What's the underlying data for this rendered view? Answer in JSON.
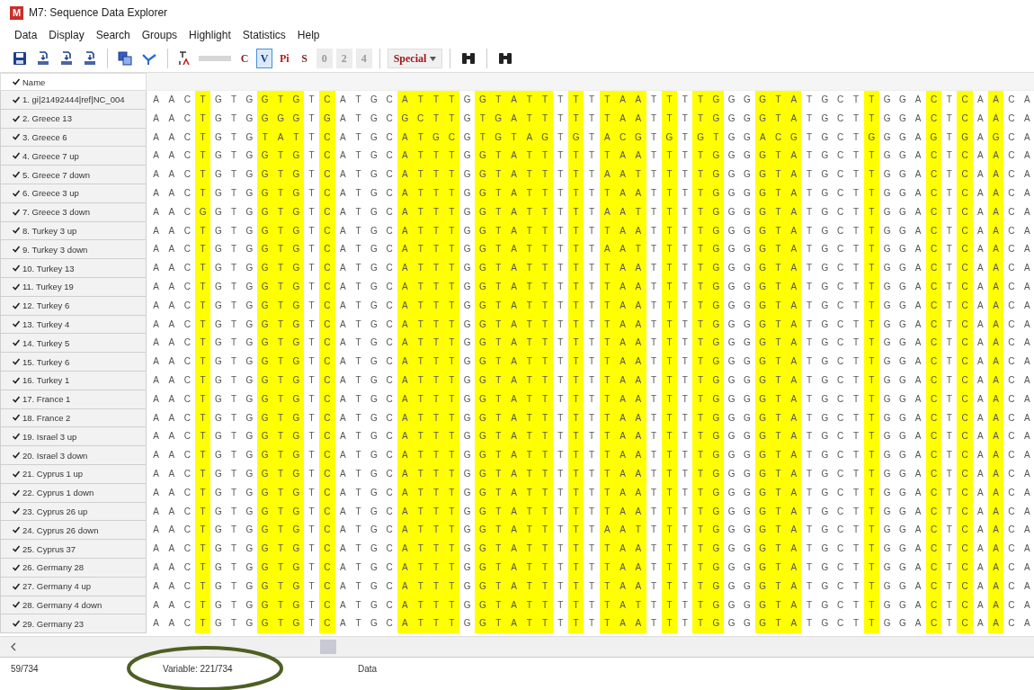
{
  "window": {
    "app_icon_letter": "M",
    "title": "M7: Sequence Data Explorer"
  },
  "menu": [
    "Data",
    "Display",
    "Search",
    "Groups",
    "Highlight",
    "Statistics",
    "Help"
  ],
  "toolbar_toggles": [
    {
      "label": "C",
      "selected": false,
      "disabled": false,
      "color": "#8b1c1c"
    },
    {
      "label": "V",
      "selected": true,
      "disabled": false,
      "color": "#1c3c8b"
    },
    {
      "label": "Pi",
      "selected": false,
      "disabled": false,
      "color": "#c01818"
    },
    {
      "label": "S",
      "selected": false,
      "disabled": false,
      "color": "#7a2a2a"
    },
    {
      "label": "0",
      "selected": false,
      "disabled": true,
      "color": "#9a9a9a"
    },
    {
      "label": "2",
      "selected": false,
      "disabled": true,
      "color": "#9a9a9a"
    },
    {
      "label": "4",
      "selected": false,
      "disabled": true,
      "color": "#9a9a9a"
    }
  ],
  "special_menu": {
    "label": "Special"
  },
  "name_header": {
    "label": "Name",
    "checked": true
  },
  "sites": [
    {
      "variable": false
    },
    {
      "variable": false
    },
    {
      "variable": false
    },
    {
      "variable": true
    },
    {
      "variable": false
    },
    {
      "variable": false
    },
    {
      "variable": false
    },
    {
      "variable": true
    },
    {
      "variable": true
    },
    {
      "variable": true
    },
    {
      "variable": false
    },
    {
      "variable": true
    },
    {
      "variable": false
    },
    {
      "variable": false
    },
    {
      "variable": false
    },
    {
      "variable": false
    },
    {
      "variable": true
    },
    {
      "variable": true
    },
    {
      "variable": true
    },
    {
      "variable": true
    },
    {
      "variable": false
    },
    {
      "variable": true
    },
    {
      "variable": true
    },
    {
      "variable": true
    },
    {
      "variable": true
    },
    {
      "variable": true
    },
    {
      "variable": false
    },
    {
      "variable": true
    },
    {
      "variable": false
    },
    {
      "variable": true
    },
    {
      "variable": true
    },
    {
      "variable": true
    },
    {
      "variable": false
    },
    {
      "variable": true
    },
    {
      "variable": false
    },
    {
      "variable": true
    },
    {
      "variable": true
    },
    {
      "variable": false
    },
    {
      "variable": false
    },
    {
      "variable": true
    },
    {
      "variable": true
    },
    {
      "variable": true
    },
    {
      "variable": false
    },
    {
      "variable": false
    },
    {
      "variable": false
    },
    {
      "variable": false
    },
    {
      "variable": true
    },
    {
      "variable": false
    },
    {
      "variable": false
    },
    {
      "variable": false
    },
    {
      "variable": true
    },
    {
      "variable": false
    },
    {
      "variable": true
    },
    {
      "variable": false
    },
    {
      "variable": true
    },
    {
      "variable": false
    },
    {
      "variable": false
    }
  ],
  "rows": [
    {
      "name": "1. gi|21492444|ref|NC_004",
      "checked": true,
      "sequence": [
        "A",
        "A",
        "C",
        "T",
        "G",
        "T",
        "G",
        "G",
        "T",
        "G",
        "T",
        "C",
        "A",
        "T",
        "G",
        "C",
        "A",
        "T",
        "T",
        "T",
        "G",
        "G",
        "T",
        "A",
        "T",
        "T",
        "T",
        "T",
        "T",
        "T",
        "A",
        "A",
        "T",
        "T",
        "T",
        "T",
        "G",
        "G",
        "G",
        "G",
        "T",
        "A",
        "T",
        "G",
        "C",
        "T",
        "T",
        "G",
        "G",
        "A",
        "C",
        "T",
        "C",
        "A",
        "A",
        "C",
        "A"
      ]
    },
    {
      "name": "2. Greece 13",
      "checked": true,
      "sequence": [
        "A",
        "A",
        "C",
        "T",
        "G",
        "T",
        "G",
        "G",
        "G",
        "G",
        "T",
        "G",
        "A",
        "T",
        "G",
        "C",
        "G",
        "C",
        "T",
        "T",
        "G",
        "T",
        "G",
        "A",
        "T",
        "T",
        "T",
        "T",
        "T",
        "T",
        "A",
        "A",
        "T",
        "T",
        "T",
        "T",
        "G",
        "G",
        "G",
        "G",
        "T",
        "A",
        "T",
        "G",
        "C",
        "T",
        "T",
        "G",
        "G",
        "A",
        "C",
        "T",
        "C",
        "A",
        "A",
        "C",
        "A"
      ]
    },
    {
      "name": "3. Greece 6",
      "checked": true,
      "sequence": [
        "A",
        "A",
        "C",
        "T",
        "G",
        "T",
        "G",
        "T",
        "A",
        "T",
        "T",
        "C",
        "A",
        "T",
        "G",
        "C",
        "A",
        "T",
        "G",
        "C",
        "G",
        "T",
        "G",
        "T",
        "A",
        "G",
        "T",
        "G",
        "T",
        "A",
        "C",
        "G",
        "T",
        "G",
        "T",
        "G",
        "T",
        "G",
        "G",
        "A",
        "C",
        "G",
        "T",
        "G",
        "C",
        "T",
        "G",
        "G",
        "G",
        "A",
        "G",
        "T",
        "G",
        "A",
        "G",
        "C",
        "A"
      ]
    },
    {
      "name": "4. Greece 7 up",
      "checked": true,
      "sequence": [
        "A",
        "A",
        "C",
        "T",
        "G",
        "T",
        "G",
        "G",
        "T",
        "G",
        "T",
        "C",
        "A",
        "T",
        "G",
        "C",
        "A",
        "T",
        "T",
        "T",
        "G",
        "G",
        "T",
        "A",
        "T",
        "T",
        "T",
        "T",
        "T",
        "T",
        "A",
        "A",
        "T",
        "T",
        "T",
        "T",
        "G",
        "G",
        "G",
        "G",
        "T",
        "A",
        "T",
        "G",
        "C",
        "T",
        "T",
        "G",
        "G",
        "A",
        "C",
        "T",
        "C",
        "A",
        "A",
        "C",
        "A"
      ]
    },
    {
      "name": "5. Greece 7 down",
      "checked": true,
      "sequence": [
        "A",
        "A",
        "C",
        "T",
        "G",
        "T",
        "G",
        "G",
        "T",
        "G",
        "T",
        "C",
        "A",
        "T",
        "G",
        "C",
        "A",
        "T",
        "T",
        "T",
        "G",
        "G",
        "T",
        "A",
        "T",
        "T",
        "T",
        "T",
        "T",
        "A",
        "A",
        "T",
        "T",
        "T",
        "T",
        "T",
        "G",
        "G",
        "G",
        "G",
        "T",
        "A",
        "T",
        "G",
        "C",
        "T",
        "T",
        "G",
        "G",
        "A",
        "C",
        "T",
        "C",
        "A",
        "A",
        "C",
        "A"
      ]
    },
    {
      "name": "6. Greece 3 up",
      "checked": true,
      "sequence": [
        "A",
        "A",
        "C",
        "T",
        "G",
        "T",
        "G",
        "G",
        "T",
        "G",
        "T",
        "C",
        "A",
        "T",
        "G",
        "C",
        "A",
        "T",
        "T",
        "T",
        "G",
        "G",
        "T",
        "A",
        "T",
        "T",
        "T",
        "T",
        "T",
        "T",
        "A",
        "A",
        "T",
        "T",
        "T",
        "T",
        "G",
        "G",
        "G",
        "G",
        "T",
        "A",
        "T",
        "G",
        "C",
        "T",
        "T",
        "G",
        "G",
        "A",
        "C",
        "T",
        "C",
        "A",
        "A",
        "C",
        "A"
      ]
    },
    {
      "name": "7. Greece 3 down",
      "checked": true,
      "sequence": [
        "A",
        "A",
        "C",
        "G",
        "G",
        "T",
        "G",
        "G",
        "T",
        "G",
        "T",
        "C",
        "A",
        "T",
        "G",
        "C",
        "A",
        "T",
        "T",
        "T",
        "G",
        "G",
        "T",
        "A",
        "T",
        "T",
        "T",
        "T",
        "T",
        "A",
        "A",
        "T",
        "T",
        "T",
        "T",
        "T",
        "G",
        "G",
        "G",
        "G",
        "T",
        "A",
        "T",
        "G",
        "C",
        "T",
        "T",
        "G",
        "G",
        "A",
        "C",
        "T",
        "C",
        "A",
        "A",
        "C",
        "A"
      ]
    },
    {
      "name": "8. Turkey 3 up",
      "checked": true,
      "sequence": [
        "A",
        "A",
        "C",
        "T",
        "G",
        "T",
        "G",
        "G",
        "T",
        "G",
        "T",
        "C",
        "A",
        "T",
        "G",
        "C",
        "A",
        "T",
        "T",
        "T",
        "G",
        "G",
        "T",
        "A",
        "T",
        "T",
        "T",
        "T",
        "T",
        "T",
        "A",
        "A",
        "T",
        "T",
        "T",
        "T",
        "G",
        "G",
        "G",
        "G",
        "T",
        "A",
        "T",
        "G",
        "C",
        "T",
        "T",
        "G",
        "G",
        "A",
        "C",
        "T",
        "C",
        "A",
        "A",
        "C",
        "A"
      ]
    },
    {
      "name": "9. Turkey 3 down",
      "checked": true,
      "sequence": [
        "A",
        "A",
        "C",
        "T",
        "G",
        "T",
        "G",
        "G",
        "T",
        "G",
        "T",
        "C",
        "A",
        "T",
        "G",
        "C",
        "A",
        "T",
        "T",
        "T",
        "G",
        "G",
        "T",
        "A",
        "T",
        "T",
        "T",
        "T",
        "T",
        "A",
        "A",
        "T",
        "T",
        "T",
        "T",
        "T",
        "G",
        "G",
        "G",
        "G",
        "T",
        "A",
        "T",
        "G",
        "C",
        "T",
        "T",
        "G",
        "G",
        "A",
        "C",
        "T",
        "C",
        "A",
        "A",
        "C",
        "A"
      ]
    },
    {
      "name": "10. Turkey 13",
      "checked": true,
      "sequence": [
        "A",
        "A",
        "C",
        "T",
        "G",
        "T",
        "G",
        "G",
        "T",
        "G",
        "T",
        "C",
        "A",
        "T",
        "G",
        "C",
        "A",
        "T",
        "T",
        "T",
        "G",
        "G",
        "T",
        "A",
        "T",
        "T",
        "T",
        "T",
        "T",
        "T",
        "A",
        "A",
        "T",
        "T",
        "T",
        "T",
        "G",
        "G",
        "G",
        "G",
        "T",
        "A",
        "T",
        "G",
        "C",
        "T",
        "T",
        "G",
        "G",
        "A",
        "C",
        "T",
        "C",
        "A",
        "A",
        "C",
        "A"
      ]
    },
    {
      "name": "11. Turkey 19",
      "checked": true,
      "sequence": [
        "A",
        "A",
        "C",
        "T",
        "G",
        "T",
        "G",
        "G",
        "T",
        "G",
        "T",
        "C",
        "A",
        "T",
        "G",
        "C",
        "A",
        "T",
        "T",
        "T",
        "G",
        "G",
        "T",
        "A",
        "T",
        "T",
        "T",
        "T",
        "T",
        "T",
        "A",
        "A",
        "T",
        "T",
        "T",
        "T",
        "G",
        "G",
        "G",
        "G",
        "T",
        "A",
        "T",
        "G",
        "C",
        "T",
        "T",
        "G",
        "G",
        "A",
        "C",
        "T",
        "C",
        "A",
        "A",
        "C",
        "A"
      ]
    },
    {
      "name": "12. Turkey 6",
      "checked": true,
      "sequence": [
        "A",
        "A",
        "C",
        "T",
        "G",
        "T",
        "G",
        "G",
        "T",
        "G",
        "T",
        "C",
        "A",
        "T",
        "G",
        "C",
        "A",
        "T",
        "T",
        "T",
        "G",
        "G",
        "T",
        "A",
        "T",
        "T",
        "T",
        "T",
        "T",
        "T",
        "A",
        "A",
        "T",
        "T",
        "T",
        "T",
        "G",
        "G",
        "G",
        "G",
        "T",
        "A",
        "T",
        "G",
        "C",
        "T",
        "T",
        "G",
        "G",
        "A",
        "C",
        "T",
        "C",
        "A",
        "A",
        "C",
        "A"
      ]
    },
    {
      "name": "13. Turkey 4",
      "checked": true,
      "sequence": [
        "A",
        "A",
        "C",
        "T",
        "G",
        "T",
        "G",
        "G",
        "T",
        "G",
        "T",
        "C",
        "A",
        "T",
        "G",
        "C",
        "A",
        "T",
        "T",
        "T",
        "G",
        "G",
        "T",
        "A",
        "T",
        "T",
        "T",
        "T",
        "T",
        "T",
        "A",
        "A",
        "T",
        "T",
        "T",
        "T",
        "G",
        "G",
        "G",
        "G",
        "T",
        "A",
        "T",
        "G",
        "C",
        "T",
        "T",
        "G",
        "G",
        "A",
        "C",
        "T",
        "C",
        "A",
        "A",
        "C",
        "A"
      ]
    },
    {
      "name": "14. Turkey 5",
      "checked": true,
      "sequence": [
        "A",
        "A",
        "C",
        "T",
        "G",
        "T",
        "G",
        "G",
        "T",
        "G",
        "T",
        "C",
        "A",
        "T",
        "G",
        "C",
        "A",
        "T",
        "T",
        "T",
        "G",
        "G",
        "T",
        "A",
        "T",
        "T",
        "T",
        "T",
        "T",
        "T",
        "A",
        "A",
        "T",
        "T",
        "T",
        "T",
        "G",
        "G",
        "G",
        "G",
        "T",
        "A",
        "T",
        "G",
        "C",
        "T",
        "T",
        "G",
        "G",
        "A",
        "C",
        "T",
        "C",
        "A",
        "A",
        "C",
        "A"
      ]
    },
    {
      "name": "15. Turkey 6",
      "checked": true,
      "sequence": [
        "A",
        "A",
        "C",
        "T",
        "G",
        "T",
        "G",
        "G",
        "T",
        "G",
        "T",
        "C",
        "A",
        "T",
        "G",
        "C",
        "A",
        "T",
        "T",
        "T",
        "G",
        "G",
        "T",
        "A",
        "T",
        "T",
        "T",
        "T",
        "T",
        "T",
        "A",
        "A",
        "T",
        "T",
        "T",
        "T",
        "G",
        "G",
        "G",
        "G",
        "T",
        "A",
        "T",
        "G",
        "C",
        "T",
        "T",
        "G",
        "G",
        "A",
        "C",
        "T",
        "C",
        "A",
        "A",
        "C",
        "A"
      ]
    },
    {
      "name": "16. Turkey 1",
      "checked": true,
      "sequence": [
        "A",
        "A",
        "C",
        "T",
        "G",
        "T",
        "G",
        "G",
        "T",
        "G",
        "T",
        "C",
        "A",
        "T",
        "G",
        "C",
        "A",
        "T",
        "T",
        "T",
        "G",
        "G",
        "T",
        "A",
        "T",
        "T",
        "T",
        "T",
        "T",
        "T",
        "A",
        "A",
        "T",
        "T",
        "T",
        "T",
        "G",
        "G",
        "G",
        "G",
        "T",
        "A",
        "T",
        "G",
        "C",
        "T",
        "T",
        "G",
        "G",
        "A",
        "C",
        "T",
        "C",
        "A",
        "A",
        "C",
        "A"
      ]
    },
    {
      "name": "17. France 1",
      "checked": true,
      "sequence": [
        "A",
        "A",
        "C",
        "T",
        "G",
        "T",
        "G",
        "G",
        "T",
        "G",
        "T",
        "C",
        "A",
        "T",
        "G",
        "C",
        "A",
        "T",
        "T",
        "T",
        "G",
        "G",
        "T",
        "A",
        "T",
        "T",
        "T",
        "T",
        "T",
        "T",
        "A",
        "A",
        "T",
        "T",
        "T",
        "T",
        "G",
        "G",
        "G",
        "G",
        "T",
        "A",
        "T",
        "G",
        "C",
        "T",
        "T",
        "G",
        "G",
        "A",
        "C",
        "T",
        "C",
        "A",
        "A",
        "C",
        "A"
      ]
    },
    {
      "name": "18. France 2",
      "checked": true,
      "sequence": [
        "A",
        "A",
        "C",
        "T",
        "G",
        "T",
        "G",
        "G",
        "T",
        "G",
        "T",
        "C",
        "A",
        "T",
        "G",
        "C",
        "A",
        "T",
        "T",
        "T",
        "G",
        "G",
        "T",
        "A",
        "T",
        "T",
        "T",
        "T",
        "T",
        "T",
        "A",
        "A",
        "T",
        "T",
        "T",
        "T",
        "G",
        "G",
        "G",
        "G",
        "T",
        "A",
        "T",
        "G",
        "C",
        "T",
        "T",
        "G",
        "G",
        "A",
        "C",
        "T",
        "C",
        "A",
        "A",
        "C",
        "A"
      ]
    },
    {
      "name": "19. Israel 3 up",
      "checked": true,
      "sequence": [
        "A",
        "A",
        "C",
        "T",
        "G",
        "T",
        "G",
        "G",
        "T",
        "G",
        "T",
        "C",
        "A",
        "T",
        "G",
        "C",
        "A",
        "T",
        "T",
        "T",
        "G",
        "G",
        "T",
        "A",
        "T",
        "T",
        "T",
        "T",
        "T",
        "T",
        "A",
        "A",
        "T",
        "T",
        "T",
        "T",
        "G",
        "G",
        "G",
        "G",
        "T",
        "A",
        "T",
        "G",
        "C",
        "T",
        "T",
        "G",
        "G",
        "A",
        "C",
        "T",
        "C",
        "A",
        "A",
        "C",
        "A"
      ]
    },
    {
      "name": "20. Israel 3 down",
      "checked": true,
      "sequence": [
        "A",
        "A",
        "C",
        "T",
        "G",
        "T",
        "G",
        "G",
        "T",
        "G",
        "T",
        "C",
        "A",
        "T",
        "G",
        "C",
        "A",
        "T",
        "T",
        "T",
        "G",
        "G",
        "T",
        "A",
        "T",
        "T",
        "T",
        "T",
        "T",
        "T",
        "A",
        "A",
        "T",
        "T",
        "T",
        "T",
        "G",
        "G",
        "G",
        "G",
        "T",
        "A",
        "T",
        "G",
        "C",
        "T",
        "T",
        "G",
        "G",
        "A",
        "C",
        "T",
        "C",
        "A",
        "A",
        "C",
        "A"
      ]
    },
    {
      "name": "21. Cyprus 1 up",
      "checked": true,
      "sequence": [
        "A",
        "A",
        "C",
        "T",
        "G",
        "T",
        "G",
        "G",
        "T",
        "G",
        "T",
        "C",
        "A",
        "T",
        "G",
        "C",
        "A",
        "T",
        "T",
        "T",
        "G",
        "G",
        "T",
        "A",
        "T",
        "T",
        "T",
        "T",
        "T",
        "T",
        "A",
        "A",
        "T",
        "T",
        "T",
        "T",
        "G",
        "G",
        "G",
        "G",
        "T",
        "A",
        "T",
        "G",
        "C",
        "T",
        "T",
        "G",
        "G",
        "A",
        "C",
        "T",
        "C",
        "A",
        "A",
        "C",
        "A"
      ]
    },
    {
      "name": "22. Cyprus 1 down",
      "checked": true,
      "sequence": [
        "A",
        "A",
        "C",
        "T",
        "G",
        "T",
        "G",
        "G",
        "T",
        "G",
        "T",
        "C",
        "A",
        "T",
        "G",
        "C",
        "A",
        "T",
        "T",
        "T",
        "G",
        "G",
        "T",
        "A",
        "T",
        "T",
        "T",
        "T",
        "T",
        "T",
        "A",
        "A",
        "T",
        "T",
        "T",
        "T",
        "G",
        "G",
        "G",
        "G",
        "T",
        "A",
        "T",
        "G",
        "C",
        "T",
        "T",
        "G",
        "G",
        "A",
        "C",
        "T",
        "C",
        "A",
        "A",
        "C",
        "A"
      ]
    },
    {
      "name": "23. Cyprus 26 up",
      "checked": true,
      "sequence": [
        "A",
        "A",
        "C",
        "T",
        "G",
        "T",
        "G",
        "G",
        "T",
        "G",
        "T",
        "C",
        "A",
        "T",
        "G",
        "C",
        "A",
        "T",
        "T",
        "T",
        "G",
        "G",
        "T",
        "A",
        "T",
        "T",
        "T",
        "T",
        "T",
        "T",
        "A",
        "A",
        "T",
        "T",
        "T",
        "T",
        "G",
        "G",
        "G",
        "G",
        "T",
        "A",
        "T",
        "G",
        "C",
        "T",
        "T",
        "G",
        "G",
        "A",
        "C",
        "T",
        "C",
        "A",
        "A",
        "C",
        "A"
      ]
    },
    {
      "name": "24. Cyprus 26 down",
      "checked": true,
      "sequence": [
        "A",
        "A",
        "C",
        "T",
        "G",
        "T",
        "G",
        "G",
        "T",
        "G",
        "T",
        "C",
        "A",
        "T",
        "G",
        "C",
        "A",
        "T",
        "T",
        "T",
        "G",
        "G",
        "T",
        "A",
        "T",
        "T",
        "T",
        "T",
        "T",
        "A",
        "A",
        "T",
        "T",
        "T",
        "T",
        "T",
        "G",
        "G",
        "G",
        "G",
        "T",
        "A",
        "T",
        "G",
        "C",
        "T",
        "T",
        "G",
        "G",
        "A",
        "C",
        "T",
        "C",
        "A",
        "A",
        "C",
        "A"
      ]
    },
    {
      "name": "25. Cyprus 37",
      "checked": true,
      "sequence": [
        "A",
        "A",
        "C",
        "T",
        "G",
        "T",
        "G",
        "G",
        "T",
        "G",
        "T",
        "C",
        "A",
        "T",
        "G",
        "C",
        "A",
        "T",
        "T",
        "T",
        "G",
        "G",
        "T",
        "A",
        "T",
        "T",
        "T",
        "T",
        "T",
        "T",
        "A",
        "A",
        "T",
        "T",
        "T",
        "T",
        "G",
        "G",
        "G",
        "G",
        "T",
        "A",
        "T",
        "G",
        "C",
        "T",
        "T",
        "G",
        "G",
        "A",
        "C",
        "T",
        "C",
        "A",
        "A",
        "C",
        "A"
      ]
    },
    {
      "name": "26. Germany 28",
      "checked": true,
      "sequence": [
        "A",
        "A",
        "C",
        "T",
        "G",
        "T",
        "G",
        "G",
        "T",
        "G",
        "T",
        "C",
        "A",
        "T",
        "G",
        "C",
        "A",
        "T",
        "T",
        "T",
        "G",
        "G",
        "T",
        "A",
        "T",
        "T",
        "T",
        "T",
        "T",
        "T",
        "A",
        "A",
        "T",
        "T",
        "T",
        "T",
        "G",
        "G",
        "G",
        "G",
        "T",
        "A",
        "T",
        "G",
        "C",
        "T",
        "T",
        "G",
        "G",
        "A",
        "C",
        "T",
        "C",
        "A",
        "A",
        "C",
        "A"
      ]
    },
    {
      "name": "27. Germany 4 up",
      "checked": true,
      "sequence": [
        "A",
        "A",
        "C",
        "T",
        "G",
        "T",
        "G",
        "G",
        "T",
        "G",
        "T",
        "C",
        "A",
        "T",
        "G",
        "C",
        "A",
        "T",
        "T",
        "T",
        "G",
        "G",
        "T",
        "A",
        "T",
        "T",
        "T",
        "T",
        "T",
        "T",
        "A",
        "A",
        "T",
        "T",
        "T",
        "T",
        "G",
        "G",
        "G",
        "G",
        "T",
        "A",
        "T",
        "G",
        "C",
        "T",
        "T",
        "G",
        "G",
        "A",
        "C",
        "T",
        "C",
        "A",
        "A",
        "C",
        "A"
      ]
    },
    {
      "name": "28. Germany 4 down",
      "checked": true,
      "sequence": [
        "A",
        "A",
        "C",
        "T",
        "G",
        "T",
        "G",
        "G",
        "T",
        "G",
        "T",
        "C",
        "A",
        "T",
        "G",
        "C",
        "A",
        "T",
        "T",
        "T",
        "G",
        "G",
        "T",
        "A",
        "T",
        "T",
        "T",
        "T",
        "T",
        "T",
        "A",
        "T",
        "T",
        "T",
        "T",
        "T",
        "G",
        "G",
        "G",
        "G",
        "T",
        "A",
        "T",
        "G",
        "C",
        "T",
        "T",
        "G",
        "G",
        "A",
        "C",
        "T",
        "C",
        "A",
        "A",
        "C",
        "A"
      ]
    },
    {
      "name": "29. Germany 23",
      "checked": true,
      "sequence": [
        "A",
        "A",
        "C",
        "T",
        "G",
        "T",
        "G",
        "G",
        "T",
        "G",
        "T",
        "C",
        "A",
        "T",
        "G",
        "C",
        "A",
        "T",
        "T",
        "T",
        "G",
        "G",
        "T",
        "A",
        "T",
        "T",
        "T",
        "T",
        "T",
        "T",
        "A",
        "A",
        "T",
        "T",
        "T",
        "T",
        "G",
        "G",
        "G",
        "G",
        "T",
        "A",
        "T",
        "G",
        "C",
        "T",
        "T",
        "G",
        "G",
        "A",
        "C",
        "T",
        "C",
        "A",
        "A",
        "C",
        "A"
      ]
    }
  ],
  "status_bar": [
    "59/734",
    "Variable: 221/734",
    "Data"
  ]
}
